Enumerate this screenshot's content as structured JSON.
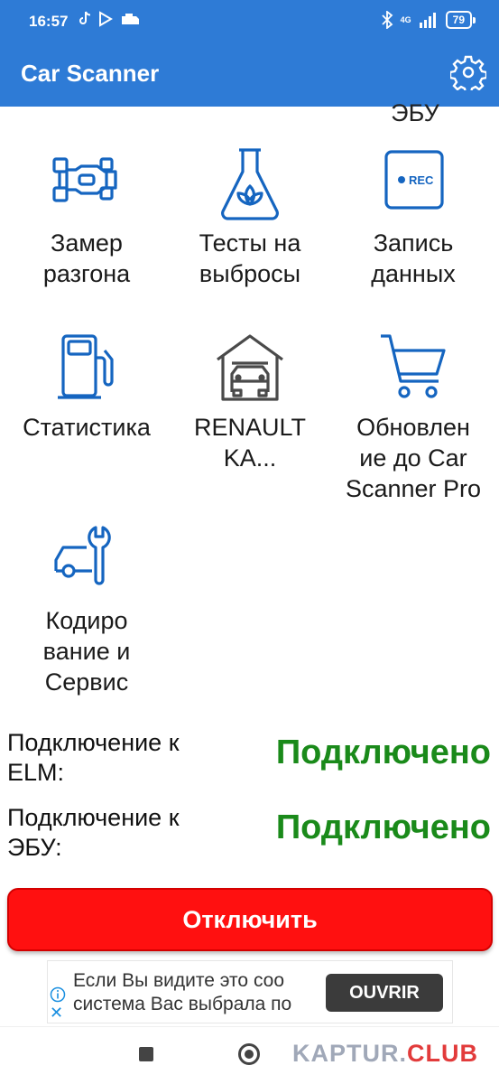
{
  "status_bar": {
    "time": "16:57",
    "network": "4G",
    "battery": "79"
  },
  "app_bar": {
    "title": "Car Scanner",
    "settings_icon": "gear-icon"
  },
  "partial_label": "ЭБУ",
  "tiles": [
    {
      "label": "Замер\nразгона",
      "icon": "race-car-icon"
    },
    {
      "label": "Тесты на\nвыбросы",
      "icon": "eco-flask-icon"
    },
    {
      "label": "Запись\nданных",
      "icon": "rec-icon"
    },
    {
      "label": "Статистика",
      "icon": "fuel-pump-icon"
    },
    {
      "label": "RENAULT\nKA...",
      "icon": "garage-icon"
    },
    {
      "label": "Обновлен\nие до Car\nScanner Pro",
      "icon": "cart-icon"
    },
    {
      "label": "Кодиро\nвание и\nСервис",
      "icon": "car-wrench-icon"
    }
  ],
  "connection": {
    "elm_label": "Подключение к ELM:",
    "elm_value": "Подключено",
    "ecu_label": "Подключение к ЭБУ:",
    "ecu_value": "Подключено"
  },
  "disconnect_label": "Отключить",
  "ad": {
    "line1": "Если Вы видите это соо",
    "line2": "система Вас выбрала по",
    "cta": "OUVRIR"
  },
  "watermark": {
    "part1": "KAPTUR.",
    "part2": "CLUB"
  },
  "colors": {
    "primary": "#2e7bd6",
    "icon_blue": "#1565c0",
    "connected_green": "#1a8a1a",
    "disconnect_red": "#ff1010"
  }
}
